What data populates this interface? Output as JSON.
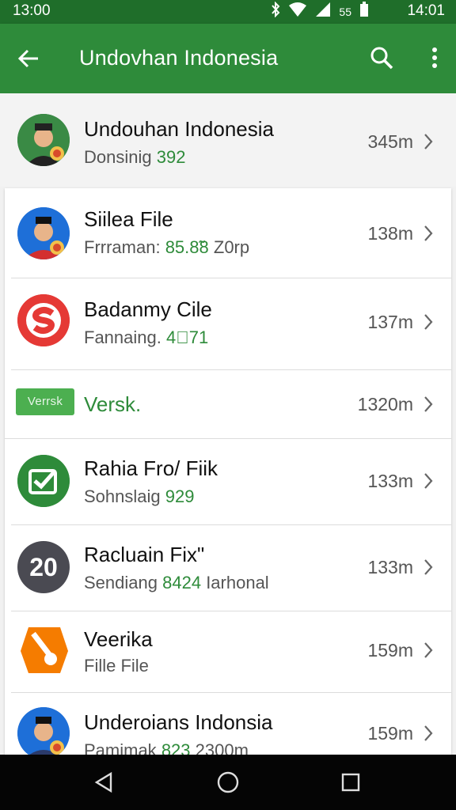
{
  "status_bar": {
    "time_left": "13:00",
    "time_right": "14:01",
    "battery_percent_label": "55"
  },
  "app_bar": {
    "title": "Undovhan Indonesia",
    "icons": [
      "back-arrow-icon",
      "search-icon",
      "more-vert-icon"
    ]
  },
  "colors": {
    "primary": "#2e8b3a",
    "primary_dark": "#1f6e2a",
    "accent_green": "#2e8b3a",
    "red": "#e53935",
    "orange": "#f57c00"
  },
  "list": {
    "header_item": {
      "name": "Undouhan Indonesia",
      "sub_prefix": "Donsinig",
      "sub_number": "392",
      "meta": "345m"
    },
    "items": [
      {
        "name": "Siilea File",
        "sub_prefix": "Frrraman:",
        "sub_number": "85.8̃8",
        "sub_suffix": "Z0rp",
        "meta": "138m",
        "avatar": "person-avatar-blue"
      },
      {
        "name": "Badanmy Cile",
        "sub_prefix": "Fannaing.",
        "sub_number": "4⃒71",
        "sub_suffix": "",
        "meta": "137m",
        "avatar": "s-logo-red"
      },
      {
        "name": "Versk.",
        "badge": "Verrsk",
        "meta": "1320m"
      },
      {
        "name": "Rahia Fro/ Fiik",
        "sub_prefix": "Sohnslaig",
        "sub_number": "929",
        "sub_suffix": "",
        "meta": "133m",
        "avatar": "check-circle-green"
      },
      {
        "name": "Racluain Fix\"",
        "sub_prefix": "Sendiang",
        "sub_number": "8424",
        "sub_suffix": "Iarhonal",
        "meta": "133m",
        "avatar": "dark-circle-20",
        "avatar_text": "20"
      },
      {
        "name": "Veerika",
        "sub_prefix": "Fille File",
        "sub_number": "",
        "sub_suffix": "",
        "meta": "159m",
        "avatar": "orange-hexagon-icon"
      },
      {
        "name": "Underoians Indonsia",
        "sub_prefix": "Pamimak",
        "sub_number": "823",
        "sub_suffix": "2300m",
        "meta": "159m",
        "avatar": "person-avatar-blue"
      }
    ]
  },
  "nav_bar": {
    "buttons": [
      "back-triangle-icon",
      "home-circle-icon",
      "recents-square-icon"
    ]
  }
}
